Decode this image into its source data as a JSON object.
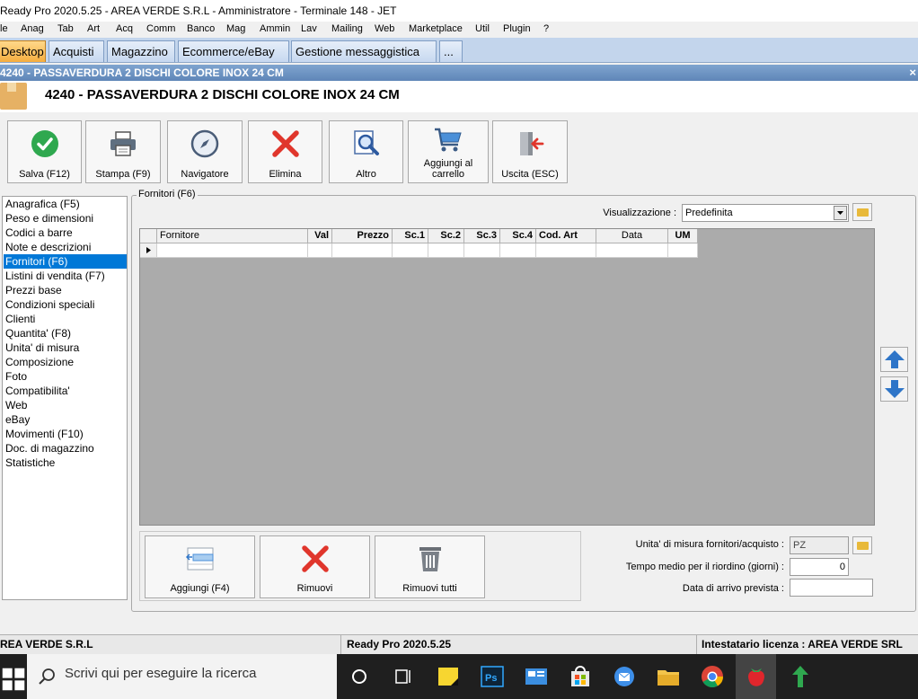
{
  "window": {
    "title": "Ready Pro 2020.5.25 - AREA VERDE S.R.L - Amministratore - Terminale 148 - JET"
  },
  "menu": [
    "le",
    "Anag",
    "Tab",
    "Art",
    "Acq",
    "Comm",
    "Banco",
    "Mag",
    "Ammin",
    "Lav",
    "Mailing",
    "Web",
    "Marketplace",
    "Util",
    "Plugin",
    "?"
  ],
  "tabs": [
    "Desktop",
    "Acquisti",
    "Magazzino",
    "Ecommerce/eBay",
    "Gestione messaggistica",
    "..."
  ],
  "document": {
    "caption": "4240 -  PASSAVERDURA 2 DISCHI COLORE INOX 24 CM",
    "header_title": "4240 -  PASSAVERDURA 2 DISCHI COLORE INOX 24 CM",
    "close_glyph": "×"
  },
  "toolbar": [
    {
      "label": "Salva (F12)",
      "icon": "check-icon"
    },
    {
      "label": "Stampa (F9)",
      "icon": "printer-icon"
    },
    {
      "label": "Navigatore",
      "icon": "compass-icon"
    },
    {
      "label": "Elimina",
      "icon": "delete-x-icon"
    },
    {
      "label": "Altro",
      "icon": "magnifier-icon"
    },
    {
      "label_line1": "Aggiungi al",
      "label_line2": "carrello",
      "icon": "cart-icon"
    },
    {
      "label": "Uscita (ESC)",
      "icon": "exit-door-icon"
    }
  ],
  "nav": [
    "Anagrafica (F5)",
    "Peso e dimensioni",
    "Codici a barre",
    "Note e descrizioni",
    "Fornitori (F6)",
    "Listini di vendita (F7)",
    "Prezzi base",
    "Condizioni speciali",
    "Clienti",
    "Quantita' (F8)",
    "Unita' di misura",
    "Composizione",
    "Foto",
    "Compatibilita'",
    "Web",
    "eBay",
    "Movimenti (F10)",
    "Doc. di magazzino",
    "Statistiche"
  ],
  "nav_selected_index": 4,
  "panel": {
    "group_label": "Fornitori (F6)",
    "view_label": "Visualizzazione :",
    "view_value": "Predefinita"
  },
  "grid": {
    "columns": [
      "Fornitore",
      "Val",
      "Prezzo",
      "Sc.1",
      "Sc.2",
      "Sc.3",
      "Sc.4",
      "Cod. Art",
      "Data",
      "UM"
    ],
    "rows": []
  },
  "bottom_buttons": [
    {
      "label": "Aggiungi (F4)",
      "icon": "add-row-icon"
    },
    {
      "label": "Rimuovi",
      "icon": "remove-x-icon"
    },
    {
      "label": "Rimuovi tutti",
      "icon": "trash-icon"
    }
  ],
  "form": {
    "um_label": "Unita' di misura fornitori/acquisto :",
    "um_value": "PZ",
    "tempo_label": "Tempo medio per il riordino (giorni) :",
    "tempo_value": "0",
    "data_label": "Data di arrivo prevista :",
    "data_value": ""
  },
  "status": {
    "company": "REA VERDE S.R.L",
    "version": "Ready Pro 2020.5.25",
    "license": "Intestatario licenza : AREA VERDE SRL"
  },
  "taskbar": {
    "search_placeholder": "Scrivi qui per eseguire la ricerca"
  },
  "colors": {
    "selection": "#0078d7",
    "active_tab": "#f5ad3f",
    "caption": "#6a90c0",
    "grid_bg": "#ababab",
    "delete_red": "#e0362c",
    "confirm_green": "#2fa84f",
    "arrow_blue": "#2e75c8"
  }
}
